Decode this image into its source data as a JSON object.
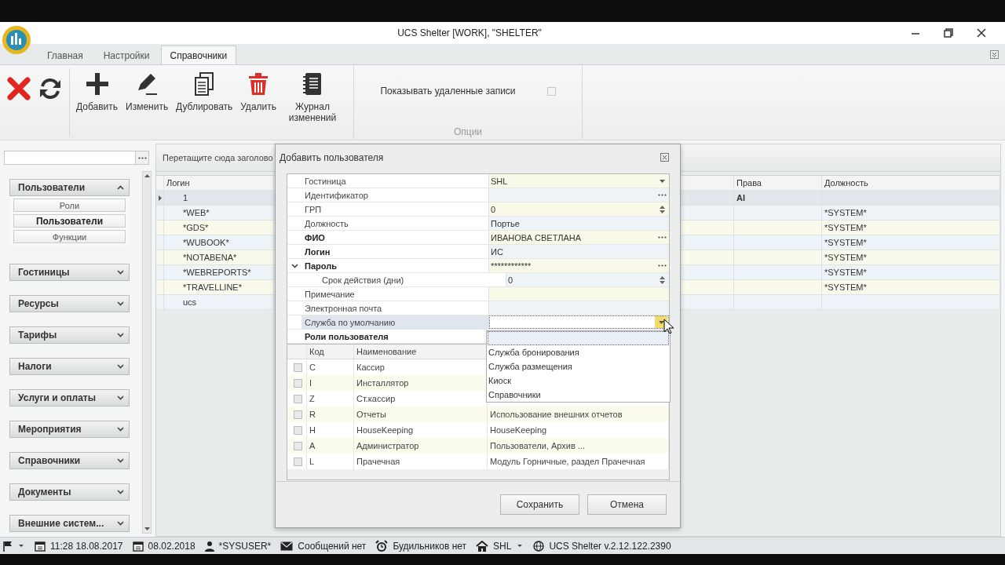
{
  "window": {
    "title": "UCS Shelter [WORK], \"SHELTER\""
  },
  "ribbon_tabs": [
    {
      "label": "Главная",
      "selected": false
    },
    {
      "label": "Настройки",
      "selected": false
    },
    {
      "label": "Справочники",
      "selected": true
    }
  ],
  "toolbar": {
    "buttons": [
      {
        "kind": "cancel"
      },
      {
        "kind": "refresh"
      },
      {
        "kind": "add",
        "label": "Добавить"
      },
      {
        "kind": "edit",
        "label": "Изменить"
      },
      {
        "kind": "duplicate",
        "label": "Дублировать"
      },
      {
        "kind": "delete",
        "label": "Удалить"
      },
      {
        "kind": "log",
        "label": "Журнал изменений"
      }
    ],
    "options": {
      "label": "Показывать удаленные записи",
      "checked": false,
      "group": "Опции"
    }
  },
  "sidebar": {
    "groups": [
      {
        "label": "Пользователи",
        "expanded": true,
        "children": [
          {
            "label": "Роли",
            "selected": false
          },
          {
            "label": "Пользователи",
            "selected": true
          },
          {
            "label": "Функции",
            "selected": false
          }
        ]
      },
      {
        "label": "Гостиницы",
        "expanded": false
      },
      {
        "label": "Ресурсы",
        "expanded": false
      },
      {
        "label": "Тарифы",
        "expanded": false
      },
      {
        "label": "Налоги",
        "expanded": false
      },
      {
        "label": "Услуги и оплаты",
        "expanded": false
      },
      {
        "label": "Мероприятия",
        "expanded": false
      },
      {
        "label": "Справочники",
        "expanded": false
      },
      {
        "label": "Документы",
        "expanded": false
      },
      {
        "label": "Внешние систем...",
        "expanded": false
      }
    ]
  },
  "grid": {
    "group_hint": "Перетащите сюда заголово",
    "columns": {
      "login": "Логин",
      "rights": "Права",
      "position": "Должность"
    },
    "rows": [
      {
        "login": "1",
        "rights": "AI",
        "selected": true
      },
      {
        "login": "*WEB*",
        "position": "*SYSTEM*",
        "selected": false
      },
      {
        "login": "*GDS*",
        "position": "*SYSTEM*",
        "selected": false
      },
      {
        "login": "*WUBOOK*",
        "position": "*SYSTEM*",
        "selected": false
      },
      {
        "login": "*NOTABENA*",
        "position": "*SYSTEM*",
        "selected": false
      },
      {
        "login": "*WEBREPORTS*",
        "position": "*SYSTEM*",
        "selected": false
      },
      {
        "login": "*TRAVELLINE*",
        "position": "*SYSTEM*",
        "selected": false
      },
      {
        "login": "ucs",
        "selected": false
      }
    ]
  },
  "dialog": {
    "title": "Добавить пользователя",
    "properties": [
      {
        "label": "Гостиница",
        "value": "SHL",
        "kind": "dropdown",
        "bold": false,
        "selected": false
      },
      {
        "label": "Идентификатор",
        "kind": "ellipsis",
        "bold": false,
        "selected": false
      },
      {
        "label": "ГРП",
        "value": "0",
        "kind": "spin",
        "bold": false,
        "selected": false
      },
      {
        "label": "Должность",
        "value": "Портье",
        "kind": "text",
        "bold": false,
        "selected": false
      },
      {
        "label": "ФИО",
        "value": "ИВАНОВА СВЕТЛАНА",
        "kind": "ellipsis",
        "bold": true,
        "selected": false
      },
      {
        "label": "Логин",
        "value": "ИС",
        "kind": "text",
        "bold": true,
        "selected": false
      },
      {
        "label": "Пароль",
        "value": "************",
        "kind": "ellipsis",
        "bold": true,
        "selected": false,
        "expanded": true,
        "children": [
          {
            "label": "Срок действия (дни)",
            "value": "0",
            "kind": "spin",
            "bold": false,
            "selected": false
          }
        ]
      },
      {
        "label": "Примечание",
        "kind": "text",
        "bold": false,
        "selected": false
      },
      {
        "label": "Электронная почта",
        "kind": "text",
        "bold": false,
        "selected": false
      },
      {
        "label": "Служба по умолчанию",
        "kind": "dropdown",
        "bold": false,
        "selected": true
      },
      {
        "label": "Роли пользователя",
        "kind": "header",
        "bold": true,
        "selected": false
      }
    ],
    "dropdown_options": [
      "Служба бронирования",
      "Служба размещения",
      "Киоск",
      "Справочники"
    ],
    "roles": {
      "columns": {
        "code": "Код",
        "name": "Наименование"
      },
      "rows": [
        {
          "code": "C",
          "name": "Кассир",
          "checked": false
        },
        {
          "code": "I",
          "name": "Инсталлятор",
          "checked": false
        },
        {
          "code": "Z",
          "name": "Ст.кассир",
          "checked": false
        },
        {
          "code": "R",
          "name": "Отчеты",
          "description": "Использование внешних отчетов",
          "checked": false
        },
        {
          "code": "H",
          "name": "HouseKeeping",
          "description": "HouseKeeping",
          "checked": false
        },
        {
          "code": "A",
          "name": "Администратор",
          "description": "Пользователи, Архив ...",
          "checked": false
        },
        {
          "code": "L",
          "name": "Прачечная",
          "description": "Модуль Горничные, раздел Прачечная",
          "checked": false
        }
      ]
    },
    "buttons": [
      "Сохранить",
      "Отмена"
    ]
  },
  "status_bar": [
    {
      "kind": "flag"
    },
    {
      "kind": "clock",
      "text": "11:28 18.08.2017"
    },
    {
      "kind": "calendar",
      "text": "08.02.2018"
    },
    {
      "kind": "user",
      "text": "*SYSUSER*"
    },
    {
      "kind": "mail",
      "text": "Сообщений нет"
    },
    {
      "kind": "alarm",
      "text": "Будильников нет"
    },
    {
      "kind": "home",
      "text": "SHL"
    },
    {
      "kind": "globe",
      "text": "UCS Shelter v.2.12.122.2390"
    }
  ]
}
